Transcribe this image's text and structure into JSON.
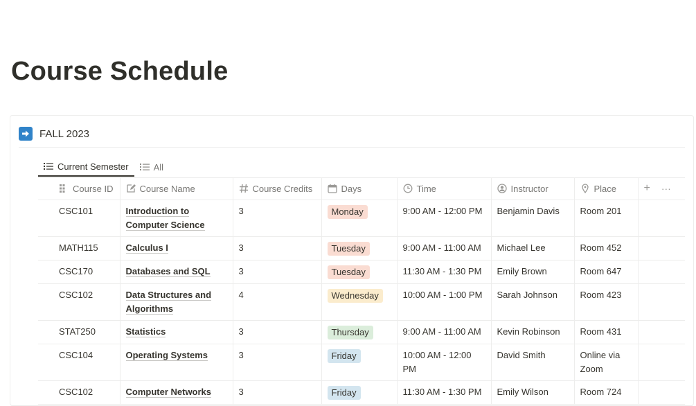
{
  "page": {
    "title": "Course Schedule"
  },
  "database": {
    "title": "FALL 2023",
    "tabs": [
      {
        "label": "Current Semester",
        "active": true
      },
      {
        "label": "All",
        "active": false
      }
    ],
    "columns": [
      {
        "label": "Course ID",
        "icon": "grid-icon"
      },
      {
        "label": "Course Name",
        "icon": "edit-icon"
      },
      {
        "label": "Course Credits",
        "icon": "hash-icon"
      },
      {
        "label": "Days",
        "icon": "calendar-icon"
      },
      {
        "label": "Time",
        "icon": "clock-icon"
      },
      {
        "label": "Instructor",
        "icon": "person-icon"
      },
      {
        "label": "Place",
        "icon": "pin-icon"
      }
    ],
    "add_column_glyph": "+",
    "more_glyph": "···",
    "rows": [
      {
        "id": "CSC101",
        "name_line1": "Introduction to",
        "name_line2": "Computer Science",
        "credits": "3",
        "day": "Monday",
        "time": "9:00 AM - 12:00 PM",
        "instructor": "Benjamin Davis",
        "place_line1": "Room 201",
        "place_line2": ""
      },
      {
        "id": "MATH115",
        "name_line1": "Calculus I",
        "name_line2": "",
        "credits": "3",
        "day": "Tuesday",
        "time": "9:00 AM - 11:00 AM",
        "instructor": "Michael Lee",
        "place_line1": "Room 452",
        "place_line2": ""
      },
      {
        "id": "CSC170",
        "name_line1": "Databases and SQL",
        "name_line2": "",
        "credits": "3",
        "day": "Tuesday",
        "time": "11:30 AM - 1:30 PM",
        "instructor": "Emily Brown",
        "place_line1": "Room 647",
        "place_line2": ""
      },
      {
        "id": "CSC102",
        "name_line1": "Data Structures and",
        "name_line2": "Algorithms",
        "credits": "4",
        "day": "Wednesday",
        "time": "10:00 AM - 1:00 PM",
        "instructor": "Sarah Johnson",
        "place_line1": "Room 423",
        "place_line2": ""
      },
      {
        "id": "STAT250",
        "name_line1": "Statistics",
        "name_line2": "",
        "credits": "3",
        "day": "Thursday",
        "time": "9:00 AM - 11:00 AM",
        "instructor": "Kevin Robinson",
        "place_line1": "Room 431",
        "place_line2": ""
      },
      {
        "id": "CSC104",
        "name_line1": "Operating Systems",
        "name_line2": "",
        "credits": "3",
        "day": "Friday",
        "time": "10:00 AM - 12:00 PM",
        "instructor": "David Smith",
        "place_line1": "Online via",
        "place_line2": "Zoom"
      },
      {
        "id": "CSC102",
        "name_line1": "Computer Networks",
        "name_line2": "",
        "credits": "3",
        "day": "Friday",
        "time": "11:30 AM - 1:30 PM",
        "instructor": "Emily Wilson",
        "place_line1": "Room 724",
        "place_line2": ""
      }
    ]
  },
  "colors": {
    "accent": "#3083c9",
    "tag_monday": "#fadcd2",
    "tag_tuesday": "#fadcd2",
    "tag_wednesday": "#fbeccd",
    "tag_thursday": "#dbeddb",
    "tag_friday": "#d3e5ef"
  }
}
